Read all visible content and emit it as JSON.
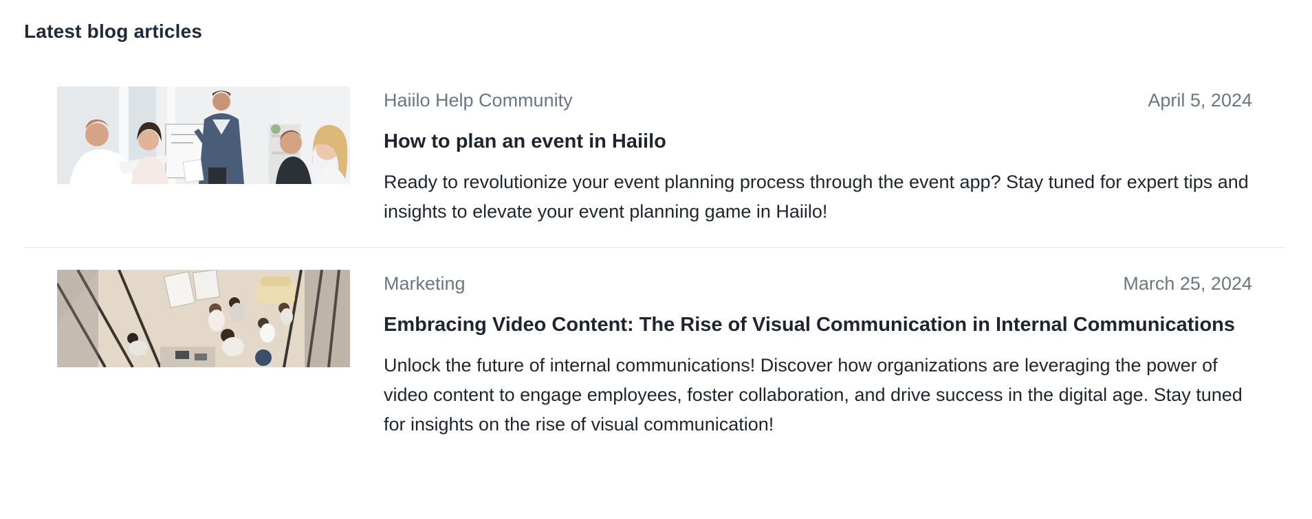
{
  "widget": {
    "title": "Latest blog articles"
  },
  "articles": [
    {
      "category": "Haiilo Help Community",
      "date": "April 5, 2024",
      "title": "How to plan an event in Haiilo",
      "excerpt": "Ready to revolutionize your event planning process through the event app? Stay tuned for expert tips and insights to elevate your event planning game in Haiilo!",
      "image": "team-meeting-photo"
    },
    {
      "category": "Marketing",
      "date": "March 25, 2024",
      "title": "Embracing Video Content: The Rise of Visual Communication in Internal Communications",
      "excerpt": "Unlock the future of internal communications! Discover how organizations are leveraging the power of video content to engage employees, foster collaboration, and drive success in the digital age. Stay tuned for insights on the rise of visual communication!",
      "image": "office-overhead-photo"
    }
  ],
  "colors": {
    "meta_text": "#6b7685",
    "title_text": "#1f2530",
    "divider": "#e5e7eb"
  }
}
